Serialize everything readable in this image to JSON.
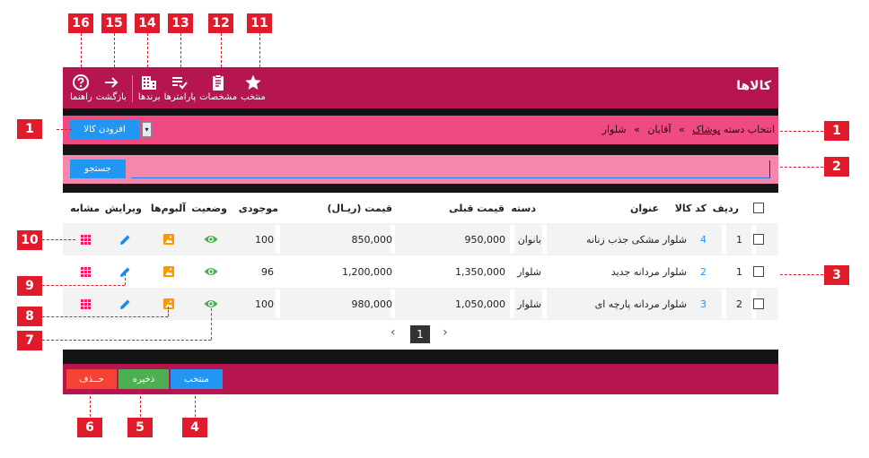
{
  "app": {
    "title": "کالاها"
  },
  "toolbar": [
    {
      "label": "راهنما",
      "icon": "help-icon"
    },
    {
      "label": "بازگشت",
      "icon": "arrow-right-icon"
    },
    {
      "label": "برندها",
      "icon": "building-icon"
    },
    {
      "label": "پارامترها",
      "icon": "list-check-icon"
    },
    {
      "label": "مشخصات",
      "icon": "clipboard-icon"
    },
    {
      "label": "منتخب",
      "icon": "star-icon"
    }
  ],
  "breadcrumb": {
    "prefix": "انتخاب دسته",
    "items": [
      "پوشاک",
      "آقایان",
      "شلوار"
    ],
    "separator": "»"
  },
  "add_button": "افزودن کالا",
  "category_select": "▾",
  "search": {
    "button": "جستجو",
    "value": ""
  },
  "table": {
    "headers": [
      "ردیف",
      "کد کالا",
      "عنوان",
      "دسته",
      "قیمت قبلی",
      "قیمت (ریـال)",
      "موجودی",
      "وضعیت",
      "آلبوم‌ها",
      "ویرایش",
      "مشابه"
    ],
    "rows": [
      {
        "index": "1",
        "code": "4",
        "title": "شلوار مشکی جذب زنانه",
        "category": "بانوان",
        "old_price": "950,000",
        "price": "850,000",
        "stock": "100"
      },
      {
        "index": "1",
        "code": "2",
        "title": "شلوار مردانه جدید",
        "category": "شلوار",
        "old_price": "1,350,000",
        "price": "1,200,000",
        "stock": "96"
      },
      {
        "index": "2",
        "code": "3",
        "title": "شلوار مردانه پارچه ای",
        "category": "شلوار",
        "old_price": "1,050,000",
        "price": "980,000",
        "stock": "100"
      }
    ]
  },
  "pager": {
    "current": "1",
    "prev": "‹",
    "next": "›"
  },
  "footer": {
    "selected": "منتخب",
    "save": "ذخیره",
    "delete": "حــذف"
  },
  "callouts": [
    "1",
    "1",
    "2",
    "3",
    "4",
    "5",
    "6",
    "7",
    "8",
    "9",
    "10",
    "11",
    "12",
    "13",
    "14",
    "15",
    "16"
  ],
  "colors": {
    "header": "#b5164f",
    "breadcrumb_bar": "#ef4a82",
    "search_bar": "#f686ad",
    "primary": "#2196f3",
    "success": "#4caf50",
    "danger": "#f44336",
    "album": "#ff9800",
    "similar": "#e91e63",
    "callout": "#e01b2b"
  }
}
